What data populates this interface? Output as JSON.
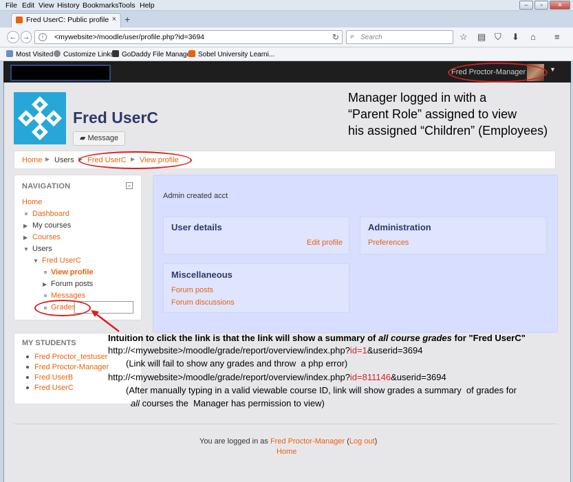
{
  "browser": {
    "menu": [
      "File",
      "Edit",
      "View",
      "History",
      "Bookmarks",
      "Tools",
      "Help"
    ],
    "tab_title": "Fred UserC: Public profile",
    "url": "<mywebsite>/moodle/user/profile.php?id=3694",
    "search_placeholder": "Search",
    "bookmarks": [
      "Most Visited",
      "Customize Links",
      "GoDaddy File Manager",
      "Sobel University Learni..."
    ]
  },
  "header": {
    "user_menu": "Fred Proctor-Manager"
  },
  "profile": {
    "name": "Fred UserC",
    "message_button": "Message"
  },
  "annotation_top": "Manager logged in with a\n“Parent Role” assigned to view\nhis assigned “Children” (Employees)",
  "breadcrumb": [
    "Home",
    "Users",
    "Fred UserC",
    "View profile"
  ],
  "navigation": {
    "title": "NAVIGATION",
    "items": [
      "Home",
      "Dashboard",
      "My courses",
      "Courses",
      "Users",
      "Fred UserC",
      "View profile",
      "Forum posts",
      "Messages",
      "Grades"
    ]
  },
  "students": {
    "title": "MY STUDENTS",
    "items": [
      "Fred Proctor_testuser",
      "Fred Proctor-Manager",
      "Fred UserB",
      "Fred UserC"
    ]
  },
  "content": {
    "created": "Admin created acct",
    "user_details": {
      "title": "User details",
      "link": "Edit profile"
    },
    "administration": {
      "title": "Administration",
      "link": "Preferences"
    },
    "misc": {
      "title": "Miscellaneous",
      "links": [
        "Forum posts",
        "Forum discussions"
      ]
    }
  },
  "annotation_bottom": {
    "l1a": "Intuition to click the link is that the link will show a summary of ",
    "l1b": "all course grades",
    "l1c": " for \"Fred UserC\"",
    "l2a": "http://<mywebsite>/moodle/grade/report/overview/index.php?",
    "l2b": "id=1",
    "l2c": "&userid=3694",
    "l3": "(Link will fail to show any grades and throw  a php error)",
    "l4a": "http://<mywebsite>/moodle/grade/report/overview/index.php?",
    "l4b": "id=811146",
    "l4c": "&userid=3694",
    "l5": "(After manually typing in a valid viewable course ID, link will show grades a summary  of grades for",
    "l6a": "all",
    "l6b": " courses the  Manager has permission to view)"
  },
  "footer": {
    "logged_in_prefix": "You are logged in as ",
    "user": "Fred Proctor-Manager",
    "logout": "Log out",
    "home": "Home"
  },
  "colors": {
    "link": "#e8620c",
    "annotation_red": "#d91f1f",
    "content_bg": "#d8deff",
    "heading": "#2d3a6a"
  }
}
